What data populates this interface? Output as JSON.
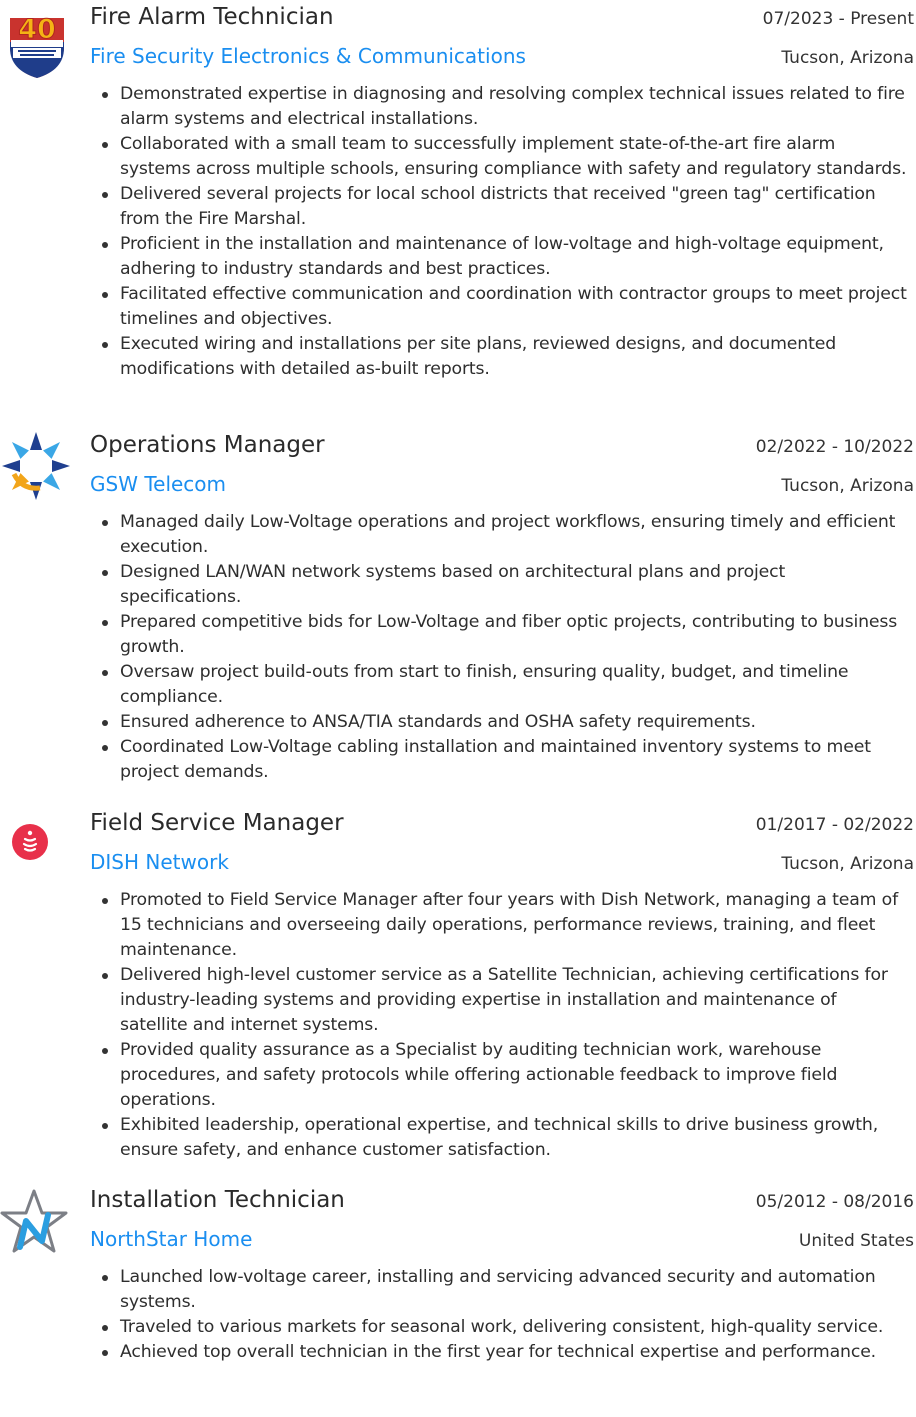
{
  "jobs": [
    {
      "title": "Fire Alarm Technician",
      "dates": "07/2023 - Present",
      "company": "Fire Security Electronics & Communications",
      "location": "Tucson, Arizona",
      "logo_icon": "fsec-40-years-badge-icon",
      "logo_text": "40",
      "bullets": [
        "Demonstrated expertise in diagnosing and resolving complex technical issues related to fire alarm systems and electrical installations.",
        "Collaborated with a small team to successfully implement state-of-the-art fire alarm systems across multiple schools, ensuring compliance with safety and regulatory standards.",
        "Delivered several projects for local school districts that received \"green tag\" certification from the Fire Marshal.",
        "Proficient in the installation and maintenance of low-voltage and high-voltage equipment, adhering to industry standards and best practices.",
        "Facilitated effective communication and coordination with contractor groups to meet project timelines and objectives.",
        "Executed wiring and installations per site plans, reviewed designs, and documented modifications with detailed as-built reports."
      ]
    },
    {
      "title": "Operations Manager",
      "dates": "02/2022 - 10/2022",
      "company": "GSW Telecom",
      "location": "Tucson, Arizona",
      "logo_icon": "gsw-sunburst-icon",
      "bullets": [
        "Managed daily Low-Voltage operations and project workflows, ensuring timely and efficient execution.",
        "Designed LAN/WAN network systems based on architectural plans and project specifications.",
        "Prepared competitive bids for Low-Voltage and fiber optic projects, contributing to business growth.",
        "Oversaw project build-outs from start to finish, ensuring quality, budget, and timeline compliance.",
        "Ensured adherence to ANSA/TIA standards and OSHA safety requirements.",
        "Coordinated Low-Voltage cabling installation and maintained inventory systems to meet project demands."
      ]
    },
    {
      "title": "Field Service Manager",
      "dates": "01/2017 - 02/2022",
      "company": "DISH Network",
      "location": "Tucson, Arizona",
      "logo_icon": "dish-signal-icon",
      "bullets": [
        "Promoted to Field Service Manager after four years with Dish Network, managing a team of 15 technicians and overseeing daily operations, performance reviews, training, and fleet maintenance.",
        "Delivered high-level customer service as a Satellite Technician, achieving certifications for industry-leading systems and providing expertise in installation and maintenance of satellite and internet systems.",
        "Provided quality assurance as a Specialist by auditing technician work, warehouse procedures, and safety protocols while offering actionable feedback to improve field operations.",
        "Exhibited leadership, operational expertise, and technical skills to drive business growth, ensure safety, and enhance customer satisfaction."
      ]
    },
    {
      "title": "Installation Technician",
      "dates": "05/2012 - 08/2016",
      "company": "NorthStar Home",
      "location": "United States",
      "logo_icon": "northstar-star-icon",
      "bullets": [
        "Launched low-voltage career, installing and servicing advanced security and automation systems.",
        "Traveled to various markets for seasonal work, delivering consistent, high-quality service.",
        "Achieved top overall technician in the first year for technical expertise and performance."
      ]
    }
  ],
  "colors": {
    "link": "#1a8ef0",
    "text": "#2e2e2e",
    "dish_red": "#e8304a",
    "gsw_navy": "#1f3f8f",
    "gsw_sky": "#3aa7e6",
    "gsw_gold": "#f2a51a",
    "northstar_gray": "#7c7f86",
    "northstar_blue": "#2b9ee0"
  }
}
